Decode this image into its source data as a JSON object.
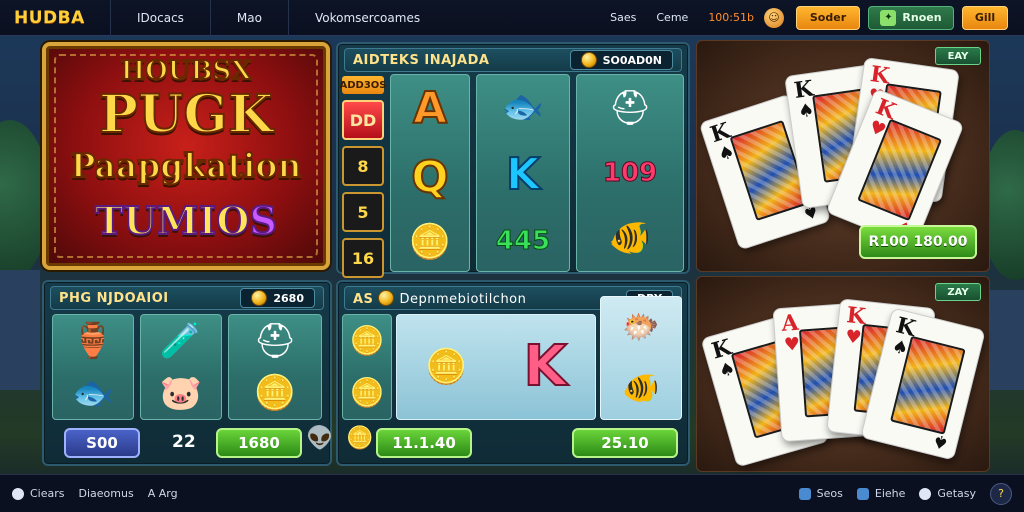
{
  "topbar": {
    "logo": "HUDBA",
    "nav": [
      "IDocacs",
      "Mao",
      "Vokomsercoames"
    ],
    "right_links": [
      "Saes",
      "Ceme",
      "100:51b"
    ],
    "btn_orange": "Soder",
    "btn_green": "Rnoen",
    "btn_orange2": "Gill"
  },
  "title_art": {
    "line1": "HOUBSX",
    "line2": "PUGK",
    "line3": "Paapgkation",
    "line4a": "TUMIO",
    "line4b": "S"
  },
  "slot_top": {
    "title": "AIDTEKS INAJADA",
    "badge": "SO0AD0N",
    "side_label": "ADD3OS",
    "side_cells": [
      "DD",
      "8",
      "5",
      "16"
    ],
    "reels": [
      [
        "A",
        "Q",
        "gold-coin"
      ],
      [
        "red-fish",
        "K",
        "445"
      ],
      [
        "golden-helmet",
        "109",
        "green-fish"
      ]
    ]
  },
  "slot_left": {
    "title": "PHG NJDOAIOI",
    "badge": "2680",
    "reels": [
      [
        "golden-chest",
        "blue-fish"
      ],
      [
        "green-bottle",
        "pink-pig"
      ],
      [
        "bronze-helmet",
        "gold-coin"
      ]
    ],
    "bet": "S00",
    "lines": "22",
    "win": "1680"
  },
  "slot_mid": {
    "title_prefix": "AS",
    "title": "Depnmebiotilchon",
    "badge": "DRY",
    "big_symbol": "K",
    "left_value": "11.1.40",
    "right_value": "25.10"
  },
  "cards_top": {
    "tag": "EAY",
    "win": "R100 180.00",
    "cards": [
      {
        "rank": "K",
        "suit": "♠",
        "color": "black"
      },
      {
        "rank": "K",
        "suit": "♠",
        "color": "black"
      },
      {
        "rank": "K",
        "suit": "♥",
        "color": "red"
      },
      {
        "rank": "K",
        "suit": "♥",
        "color": "red"
      }
    ]
  },
  "cards_bottom": {
    "tag": "ZAY",
    "cards": [
      {
        "rank": "K",
        "suit": "♠",
        "color": "black"
      },
      {
        "rank": "A",
        "suit": "♥",
        "color": "red"
      },
      {
        "rank": "K",
        "suit": "♥",
        "color": "red"
      },
      {
        "rank": "K",
        "suit": "♠",
        "color": "black"
      }
    ]
  },
  "footer": {
    "left": [
      "Ciears",
      "Diaeomus",
      "A Arg"
    ],
    "right": [
      "Seos",
      "Eiehe",
      "Getasy"
    ]
  },
  "colors": {
    "accent_gold": "#ffd84a",
    "accent_orange": "#e98710",
    "accent_green": "#2e8a18",
    "panel_teal": "#153b4a"
  }
}
